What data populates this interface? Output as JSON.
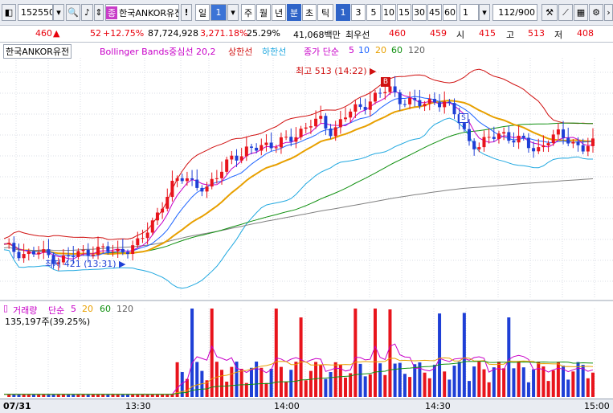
{
  "toolbar": {
    "code": "152550",
    "name": "한국ANKOR유전",
    "name_badge": "종",
    "warn": "!",
    "period_label": "일",
    "period_value": "1",
    "periods": [
      "주",
      "월",
      "년",
      "분",
      "초",
      "틱"
    ],
    "selected_period": "분",
    "intervals": [
      "1",
      "3",
      "5",
      "10",
      "15",
      "30",
      "45",
      "60"
    ],
    "selected_interval": "1",
    "custom_interval": "1",
    "count": "112",
    "total": "/900"
  },
  "info": {
    "price": "460",
    "arrow": "▲",
    "change": "52",
    "change_pct": "+12.75%",
    "volume": "87,724,928",
    "vol_ratio": "3,271.18%",
    "turnover": "25.29%",
    "amount": "41,068백만",
    "best_ask_label": "최우선",
    "best_ask": "460",
    "best_bid": "459",
    "open_label": "시",
    "open": "415",
    "high_label": "고",
    "high": "513",
    "low_label": "저",
    "low": "408"
  },
  "legend": {
    "name": "한국ANKOR유전",
    "bb": "Bollinger Bands중심선 20,2",
    "upper": "상한선",
    "lower": "하한선",
    "ma_prefix": "종가 단순",
    "ma5": "5",
    "ma10": "10",
    "ma20": "20",
    "ma60": "60",
    "ma120": "120"
  },
  "annotations": {
    "high_text": "최고 513 (14:22)",
    "low_text": "최저 421 (13:31)",
    "buy_marker": "B",
    "sell_marker": "S"
  },
  "volume_legend": {
    "label": "거래량",
    "ma_prefix": "단순",
    "ma5": "5",
    "ma20": "20",
    "ma60": "60",
    "ma120": "120",
    "current": "135,197주(39.25%)"
  },
  "xaxis": {
    "date": "07/31",
    "ticks": [
      "13:30",
      "14:00",
      "14:30",
      "15:00"
    ]
  },
  "colors": {
    "up": "#e8141c",
    "down": "#1e3fd6",
    "ma5": "#c800c8",
    "ma10": "#1e64ff",
    "ma20": "#e8a000",
    "ma60": "#109010",
    "ma120": "#808080",
    "bb_upper": "#d01010",
    "bb_lower": "#20a8e0"
  },
  "chart_data": {
    "type": "line",
    "price_range": [
      400,
      530
    ],
    "candles_summary": {
      "open": 415,
      "high": 513,
      "low": 408,
      "last": 460
    },
    "price_path": [
      428,
      426,
      424,
      425,
      423,
      421,
      423,
      425,
      427,
      426,
      425,
      428,
      430,
      440,
      452,
      462,
      466,
      462,
      458,
      468,
      478,
      476,
      482,
      484,
      482,
      486,
      490,
      494,
      496,
      490,
      498,
      502,
      506,
      510,
      513,
      508,
      506,
      504,
      508,
      505,
      498,
      486,
      482,
      487,
      490,
      486,
      484,
      480,
      486,
      488,
      486,
      481,
      483
    ],
    "volume_peak": 1300000
  }
}
